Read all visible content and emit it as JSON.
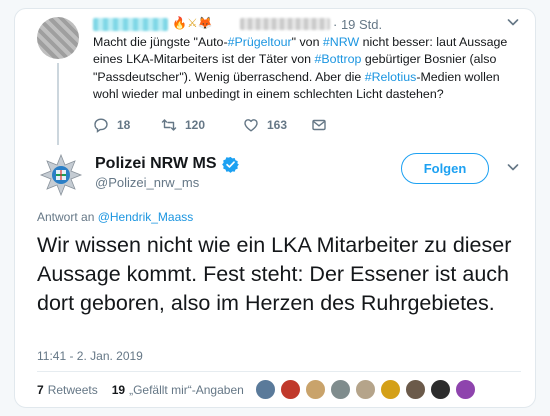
{
  "parent_tweet": {
    "emoji": "🔥⚔🦊",
    "time": "· 19 Std.",
    "text_parts": [
      {
        "text": "Macht die jüngste \"Auto-",
        "link": false
      },
      {
        "text": "#Prügeltour",
        "link": true
      },
      {
        "text": "\" von ",
        "link": false
      },
      {
        "text": "#NRW",
        "link": true
      },
      {
        "text": " nicht besser: laut Aussage eines LKA-Mitarbeiters ist der Täter von ",
        "link": false
      },
      {
        "text": "#Bottrop",
        "link": true
      },
      {
        "text": " gebürtiger Bosnier (also \"Passdeutscher\"). Wenig überraschend. Aber die ",
        "link": false
      },
      {
        "text": "#Relotius",
        "link": true
      },
      {
        "text": "-Medien wollen wohl wieder mal unbedingt in einem schlechten Licht dastehen?",
        "link": false
      }
    ],
    "replies": "18",
    "retweets": "120",
    "likes": "163"
  },
  "main_tweet": {
    "name": "Polizei NRW MS",
    "handle": "@Polizei_nrw_ms",
    "follow_label": "Folgen",
    "reply_to_prefix": "Antwort an ",
    "reply_to_handle": "@Hendrik_Maass",
    "text": "Wir wissen nicht wie ein LKA Mitarbeiter zu dieser Aussage kommt. Fest steht: Der Essener ist auch dort geboren, also im Herzen des Ruhrgebietes.",
    "timestamp": "11:41 - 2. Jan. 2019",
    "retweet_count": "7",
    "retweet_label": "Retweets",
    "like_count": "19",
    "like_label": "„Gefällt mir“-Angaben"
  },
  "colors": {
    "link": "#1b95e0",
    "accent": "#1da1f2",
    "muted": "#657786",
    "text": "#14171a"
  },
  "likers": [
    {
      "name": "liker-avatar-1",
      "color": "#5a7a9a"
    },
    {
      "name": "liker-avatar-2",
      "color": "#c0392b"
    },
    {
      "name": "liker-avatar-3",
      "color": "#c9a36b"
    },
    {
      "name": "liker-avatar-4",
      "color": "#7f8c8d"
    },
    {
      "name": "liker-avatar-5",
      "color": "#b5a48a"
    },
    {
      "name": "liker-avatar-6",
      "color": "#d4a017"
    },
    {
      "name": "liker-avatar-7",
      "color": "#6b5a4a"
    },
    {
      "name": "liker-avatar-8",
      "color": "#2c2c2c"
    },
    {
      "name": "liker-avatar-9",
      "color": "#8e44ad"
    }
  ]
}
